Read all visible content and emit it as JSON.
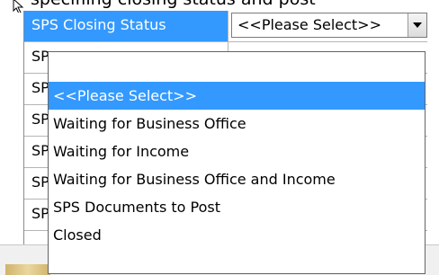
{
  "header": {
    "clipped_text": "specifiing closing status and post"
  },
  "grid": {
    "rows": [
      {
        "label": "SPS Closing Status",
        "selected": true
      },
      {
        "label": "SP",
        "selected": false
      },
      {
        "label": "SP",
        "selected": false
      },
      {
        "label": "SP",
        "selected": false
      },
      {
        "label": "SP",
        "selected": false
      },
      {
        "label": "SP",
        "selected": false
      },
      {
        "label": "SP",
        "selected": false
      }
    ]
  },
  "combo": {
    "value": "<<Please Select>>"
  },
  "dropdown": {
    "options": [
      {
        "label": "",
        "highlighted": false
      },
      {
        "label": "<<Please Select>>",
        "highlighted": true
      },
      {
        "label": "Waiting for Business Office",
        "highlighted": false
      },
      {
        "label": "Waiting for Income",
        "highlighted": false
      },
      {
        "label": "Waiting for Business Office and Income",
        "highlighted": false
      },
      {
        "label": "SPS Documents to Post",
        "highlighted": false
      },
      {
        "label": "Closed",
        "highlighted": false
      }
    ]
  },
  "colors": {
    "selection": "#3399ff",
    "border": "#646464"
  }
}
